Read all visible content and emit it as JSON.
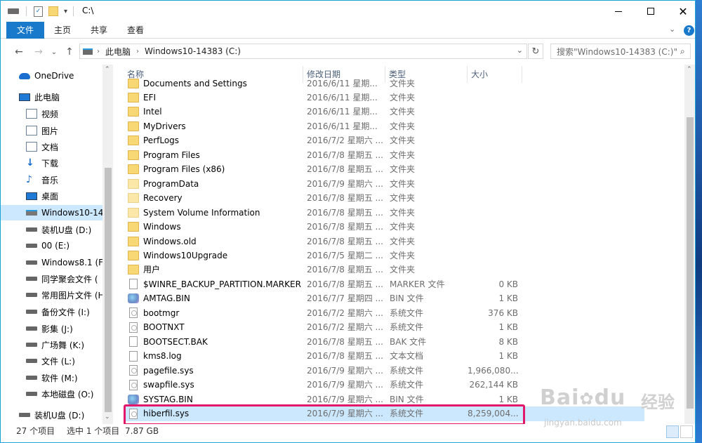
{
  "window": {
    "title": "C:\\"
  },
  "ribbon": {
    "tabs": [
      "文件",
      "主页",
      "共享",
      "查看"
    ]
  },
  "address": {
    "path": [
      "此电脑",
      "Windows10-14383 (C:)"
    ],
    "search_placeholder": "搜索\"Windows10-14383 (C:)\""
  },
  "nav_tree": [
    {
      "label": "OneDrive",
      "icon": "onedrive-icon"
    },
    {
      "label": "此电脑",
      "icon": "pc-icon"
    },
    {
      "label": "视频",
      "icon": "video-folder-icon"
    },
    {
      "label": "图片",
      "icon": "pictures-folder-icon"
    },
    {
      "label": "文档",
      "icon": "documents-folder-icon"
    },
    {
      "label": "下载",
      "icon": "download-icon"
    },
    {
      "label": "音乐",
      "icon": "music-icon"
    },
    {
      "label": "桌面",
      "icon": "desktop-icon"
    },
    {
      "label": "Windows10-14",
      "icon": "system-drive-icon",
      "selected": true
    },
    {
      "label": "装机U盘 (D:)",
      "icon": "drive-icon"
    },
    {
      "label": "00 (E:)",
      "icon": "drive-icon"
    },
    {
      "label": "Windows8.1 (F:",
      "icon": "drive-icon"
    },
    {
      "label": "同学聚会文件 (",
      "icon": "drive-icon"
    },
    {
      "label": "常用图片文件 (H",
      "icon": "drive-icon"
    },
    {
      "label": "备份文件 (I:)",
      "icon": "drive-icon"
    },
    {
      "label": "影集 (J:)",
      "icon": "drive-icon"
    },
    {
      "label": "广场舞 (K:)",
      "icon": "drive-icon"
    },
    {
      "label": "文件 (L:)",
      "icon": "drive-icon"
    },
    {
      "label": "软件 (M:)",
      "icon": "drive-icon"
    },
    {
      "label": "本地磁盘 (O:)",
      "icon": "drive-icon"
    },
    {
      "label": "装机U盘 (D:)",
      "icon": "drive-icon"
    }
  ],
  "columns": {
    "name": "名称",
    "date": "修改日期",
    "type": "类型",
    "size": "大小"
  },
  "files": [
    {
      "name": "Documents and Settings",
      "date": "2016/6/11 星期...",
      "type": "文件夹",
      "size": "",
      "icon": "shortcut-folder-icon"
    },
    {
      "name": "EFI",
      "date": "2016/6/11 星期...",
      "type": "文件夹",
      "size": "",
      "icon": "folder-icon"
    },
    {
      "name": "Intel",
      "date": "2016/6/11 星期...",
      "type": "文件夹",
      "size": "",
      "icon": "folder-icon"
    },
    {
      "name": "MyDrivers",
      "date": "2016/6/11 星期...",
      "type": "文件夹",
      "size": "",
      "icon": "folder-icon"
    },
    {
      "name": "PerfLogs",
      "date": "2016/7/2 星期六 ...",
      "type": "文件夹",
      "size": "",
      "icon": "folder-icon"
    },
    {
      "name": "Program Files",
      "date": "2016/7/8 星期五 ...",
      "type": "文件夹",
      "size": "",
      "icon": "folder-icon"
    },
    {
      "name": "Program Files (x86)",
      "date": "2016/7/8 星期五 ...",
      "type": "文件夹",
      "size": "",
      "icon": "folder-icon"
    },
    {
      "name": "ProgramData",
      "date": "2016/7/9 星期六 ...",
      "type": "文件夹",
      "size": "",
      "icon": "hidden-folder-icon"
    },
    {
      "name": "Recovery",
      "date": "2016/7/8 星期五 ...",
      "type": "文件夹",
      "size": "",
      "icon": "hidden-folder-icon"
    },
    {
      "name": "System Volume Information",
      "date": "2016/7/8 星期五 ...",
      "type": "文件夹",
      "size": "",
      "icon": "hidden-folder-icon"
    },
    {
      "name": "Windows",
      "date": "2016/7/8 星期五 ...",
      "type": "文件夹",
      "size": "",
      "icon": "folder-icon"
    },
    {
      "name": "Windows.old",
      "date": "2016/7/8 星期五 ...",
      "type": "文件夹",
      "size": "",
      "icon": "folder-icon"
    },
    {
      "name": "Windows10Upgrade",
      "date": "2016/7/5 星期二 ...",
      "type": "文件夹",
      "size": "",
      "icon": "folder-icon"
    },
    {
      "name": "用户",
      "date": "2016/7/8 星期五 ...",
      "type": "文件夹",
      "size": "",
      "icon": "folder-icon"
    },
    {
      "name": "$WINRE_BACKUP_PARTITION.MARKER",
      "date": "2016/7/8 星期五 ...",
      "type": "MARKER 文件",
      "size": "0 KB",
      "icon": "file-icon"
    },
    {
      "name": "AMTAG.BIN",
      "date": "2016/7/7 星期四 ...",
      "type": "BIN 文件",
      "size": "1 KB",
      "icon": "bin-file-icon"
    },
    {
      "name": "bootmgr",
      "date": "2016/7/2 星期六 ...",
      "type": "系统文件",
      "size": "376 KB",
      "icon": "system-file-icon"
    },
    {
      "name": "BOOTNXT",
      "date": "2016/7/2 星期六 ...",
      "type": "系统文件",
      "size": "1 KB",
      "icon": "system-file-icon"
    },
    {
      "name": "BOOTSECT.BAK",
      "date": "2016/7/8 星期五 ...",
      "type": "BAK 文件",
      "size": "8 KB",
      "icon": "file-icon"
    },
    {
      "name": "kms8.log",
      "date": "2016/7/8 星期五 ...",
      "type": "文本文档",
      "size": "1 KB",
      "icon": "text-file-icon"
    },
    {
      "name": "pagefile.sys",
      "date": "2016/7/9 星期六 ...",
      "type": "系统文件",
      "size": "1,966,080...",
      "icon": "system-file-icon"
    },
    {
      "name": "swapfile.sys",
      "date": "2016/7/9 星期六 ...",
      "type": "系统文件",
      "size": "262,144 KB",
      "icon": "system-file-icon"
    },
    {
      "name": "SYSTAG.BIN",
      "date": "2016/7/9 星期六 ...",
      "type": "BIN 文件",
      "size": "1 KB",
      "icon": "bin-file-icon"
    },
    {
      "name": "hiberfil.sys",
      "date": "2016/7/9 星期六 ...",
      "type": "系统文件",
      "size": "8,259,004...",
      "icon": "system-file-icon",
      "selected": true
    }
  ],
  "status": {
    "count": "27 个项目",
    "selection": "选中 1 个项目",
    "size": "7.87 GB"
  },
  "watermark": {
    "brand": "Bai",
    "brand2": "du",
    "cn": "经验",
    "url": "jingyan.baidu.com"
  },
  "colors": {
    "accent": "#1979ca",
    "selection": "#cce8ff",
    "highlight": "#e3176a"
  }
}
